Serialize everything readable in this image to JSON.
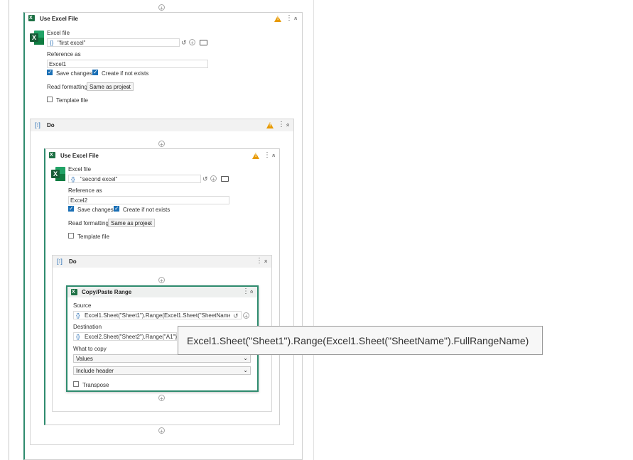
{
  "outer_excel": {
    "title": "Use Excel File",
    "excel_file_label": "Excel file",
    "excel_file_value": "\"first excel\"",
    "reference_label": "Reference as",
    "reference_value": "Excel1",
    "save_changes_label": "Save changes",
    "save_changes_checked": true,
    "create_if_not_exists_label": "Create if not exists",
    "create_if_not_exists_checked": true,
    "read_formatting_label": "Read formatting",
    "read_formatting_value": "Same as project",
    "template_file_label": "Template file",
    "template_file_checked": false
  },
  "outer_do": {
    "title": "Do"
  },
  "inner_excel": {
    "title": "Use Excel File",
    "excel_file_label": "Excel file",
    "excel_file_value": "\"second excel\"",
    "reference_label": "Reference as",
    "reference_value": "Excel2",
    "save_changes_label": "Save changes",
    "save_changes_checked": true,
    "create_if_not_exists_label": "Create if not exists",
    "create_if_not_exists_checked": true,
    "read_formatting_label": "Read formatting",
    "read_formatting_value": "Same as project",
    "template_file_label": "Template file",
    "template_file_checked": false
  },
  "inner_do": {
    "title": "Do"
  },
  "copy_paste": {
    "title": "Copy/Paste Range",
    "source_label": "Source",
    "source_value": "Excel1.Sheet(\"Sheet1\").Range(Excel1.Sheet(\"SheetName\").FullR",
    "destination_label": "Destination",
    "destination_value": "Excel2.Sheet(\"Sheet2\").Range(\"A1\")",
    "what_to_copy_label": "What to copy",
    "what_to_copy_value": "Values",
    "header_option_value": "Include header",
    "transpose_label": "Transpose",
    "transpose_checked": false
  },
  "tooltip": {
    "text": "Excel1.Sheet(\"Sheet1\").Range(Excel1.Sheet(\"SheetName\").FullRangeName)"
  },
  "icons": {
    "brace": "{}",
    "plus": "+",
    "kebab": "⋮",
    "collapse": "»",
    "dropdown": "⌄"
  },
  "colors": {
    "excel_green": "#1e7145",
    "warning": "#e89a00",
    "selected_border": "#2e8b6e",
    "accent_blue": "#1a6fb5"
  }
}
